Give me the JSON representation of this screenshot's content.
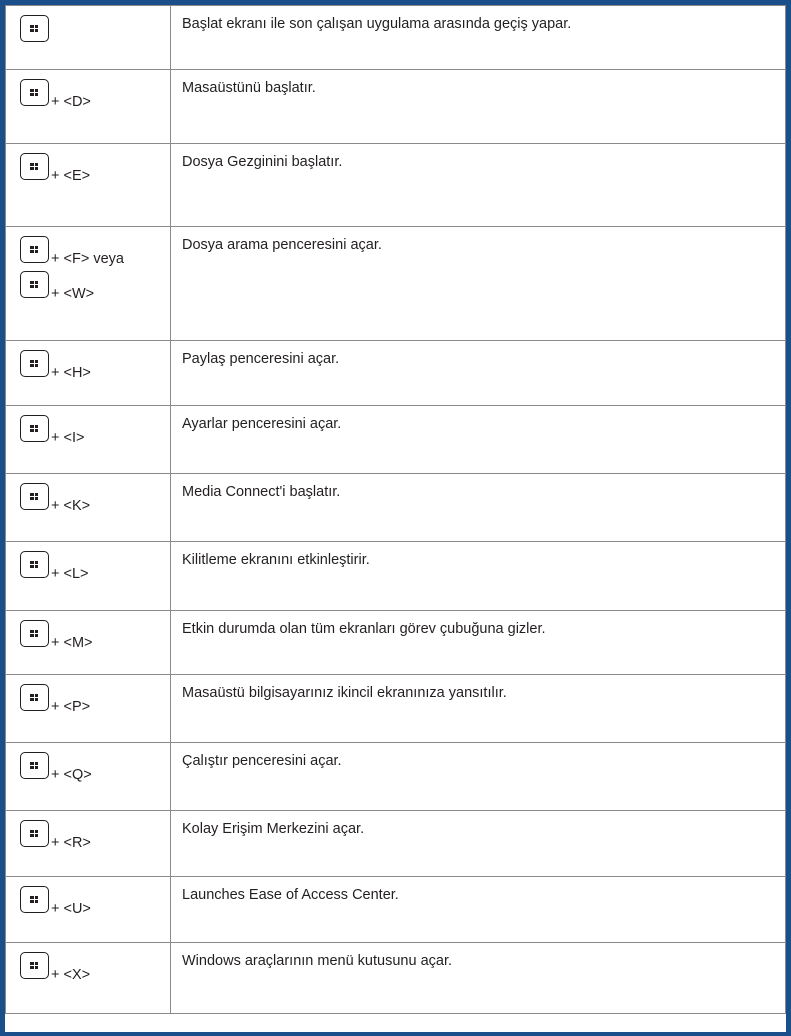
{
  "rows": [
    {
      "suffix": "",
      "description": "Başlat ekranı ile son çalışan uygulama arasında geçiş yapar."
    },
    {
      "suffix": "+ <D>",
      "description": "Masaüstünü başlatır."
    },
    {
      "suffix": "+ <E>",
      "description": "Dosya Gezginini başlatır."
    },
    {
      "suffix": "+ <F> veya",
      "suffix2": "+ <W>",
      "description": "Dosya arama penceresini açar."
    },
    {
      "suffix": "+ <H>",
      "description": "Paylaş penceresini açar."
    },
    {
      "suffix": "+ <I>",
      "description": "Ayarlar penceresini açar."
    },
    {
      "suffix": "+ <K>",
      "description": "Media Connect'i başlatır."
    },
    {
      "suffix": "+ <L>",
      "description": "Kilitleme ekranını etkinleştirir."
    },
    {
      "suffix": "+ <M>",
      "description": "Etkin durumda olan tüm ekranları görev çubuğuna gizler."
    },
    {
      "suffix": "+ <P>",
      "description": "Masaüstü bilgisayarınız ikincil ekranınıza yansıtılır."
    },
    {
      "suffix": "+ <Q>",
      "description": "Çalıştır penceresini açar."
    },
    {
      "suffix": "+ <R>",
      "description": "Kolay Erişim Merkezini açar."
    },
    {
      "suffix": "+ <U>",
      "description": "Launches Ease of Access Center."
    },
    {
      "suffix": "+ <X>",
      "description": "Windows araçlarının menü kutusunu açar."
    }
  ],
  "icons": {
    "key": "windows-key-icon"
  },
  "colors": {
    "frame": "#1b4f8c",
    "grid": "#8a8a8a",
    "text": "#231f20"
  }
}
